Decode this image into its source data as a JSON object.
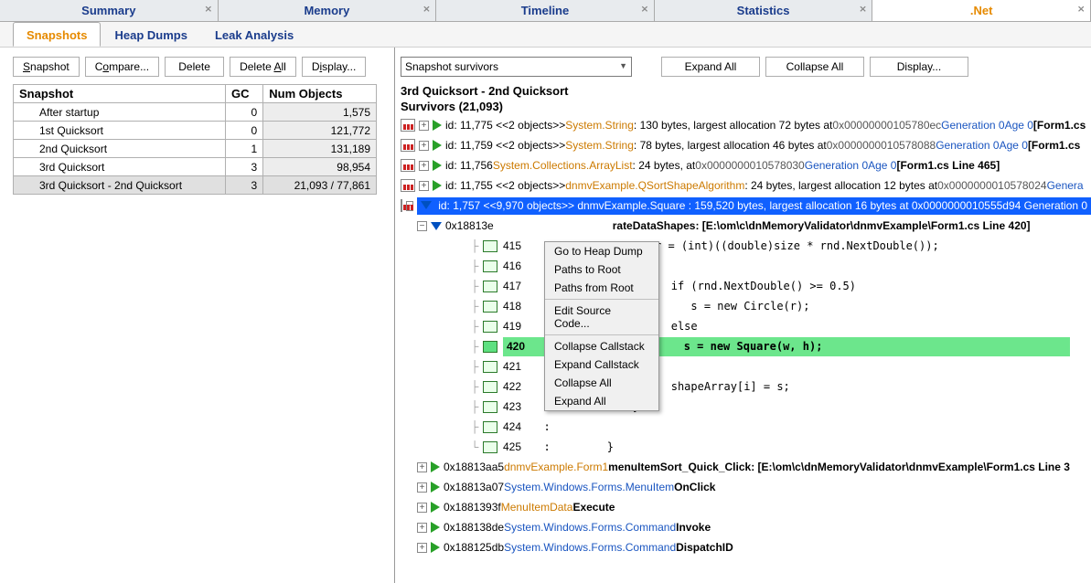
{
  "top_tabs": {
    "summary": "Summary",
    "memory": "Memory",
    "timeline": "Timeline",
    "statistics": "Statistics",
    "dotnet": ".Net"
  },
  "sub_tabs": {
    "snapshots": "Snapshots",
    "heap_dumps": "Heap Dumps",
    "leak_analysis": "Leak Analysis"
  },
  "left_toolbar": {
    "snapshot": "Snapshot",
    "compare": "Compare...",
    "delete": "Delete",
    "delete_all": "Delete All",
    "display": "Display..."
  },
  "snap_table": {
    "headers": {
      "snapshot": "Snapshot",
      "gc": "GC",
      "num": "Num Objects"
    },
    "rows": [
      {
        "name": "After startup",
        "gc": "0",
        "num": "1,575"
      },
      {
        "name": "1st Quicksort",
        "gc": "0",
        "num": "121,772"
      },
      {
        "name": "2nd Quicksort",
        "gc": "1",
        "num": "131,189"
      },
      {
        "name": "3rd Quicksort",
        "gc": "3",
        "num": "98,954"
      },
      {
        "name": "3rd Quicksort - 2nd Quicksort",
        "gc": "3",
        "num": "21,093 / 77,861"
      }
    ]
  },
  "right_toolbar": {
    "filter": "Snapshot survivors",
    "expand_all": "Expand All",
    "collapse_all": "Collapse All",
    "display": "Display..."
  },
  "diff_title": "3rd Quicksort - 2nd Quicksort",
  "survivors": "Survivors (21,093)",
  "tree_rows": {
    "r1": {
      "id": "id: 11,775 <<2 objects>> ",
      "type": "System.String",
      "rest": " : 130 bytes, largest allocation 72 bytes at ",
      "addr": "0x00000000105780ec ",
      "gen": "Generation 0 ",
      "age": "Age 0 ",
      "loc": "[Form1.cs"
    },
    "r2": {
      "id": "id: 11,759 <<2 objects>> ",
      "type": "System.String",
      "rest": " : 78 bytes, largest allocation 46 bytes at ",
      "addr": "0x0000000010578088 ",
      "gen": "Generation 0 ",
      "age": "Age 0 ",
      "loc": "[Form1.cs"
    },
    "r3": {
      "id": "id: 11,756 ",
      "type": "System.Collections.ArrayList",
      "rest": " : 24 bytes, at ",
      "addr": "0x0000000010578030 ",
      "gen": "Generation 0 ",
      "age": "Age 0 ",
      "loc": "[Form1.cs Line 465]"
    },
    "r4": {
      "id": "id: 11,755 <<2 objects>> ",
      "type": "dnmvExample.QSortShapeAlgorithm",
      "rest": " : 24 bytes, largest allocation 12 bytes at ",
      "addr": "0x0000000010578024 ",
      "gen": "Genera"
    },
    "sel": {
      "id": "id: 1,757 <<9,970 objects>> ",
      "type": "dnmvExample.Square",
      "rest": " : 159,520 bytes, largest allocation 16 bytes at ",
      "addr": "0x0000000010555d94 ",
      "gen": "Generation 0 "
    },
    "shapes": {
      "addr": "0x18813e",
      "method": "rateDataShapes",
      "path": " : [E:\\om\\c\\dnMemoryValidator\\dnmvExample\\Form1.cs Line 420]"
    },
    "code_415": "r = (int)((double)size * rnd.NextDouble());",
    "code_417": "if (rnd.NextDouble() >= 0.5)",
    "code_418": "   s = new Circle(r);",
    "code_419": "else",
    "code_420": "   s = new Square(w, h);",
    "code_422": "shapeArray[i] = s;",
    "code_423": "}",
    "code_425": "}",
    "cs1": {
      "addr": "0x18813aa5 ",
      "type": "dnmvExample.Form1",
      "method": " menuItemSort_Quick_Click",
      "path": " : [E:\\om\\c\\dnMemoryValidator\\dnmvExample\\Form1.cs Line 3"
    },
    "cs2": {
      "addr": "0x18813a07 ",
      "type": "System.Windows.Forms.MenuItem",
      "method": " OnClick"
    },
    "cs3": {
      "addr": "0x1881393f ",
      "type": "MenuItemData",
      "method": " Execute"
    },
    "cs4": {
      "addr": "0x188138de ",
      "type": "System.Windows.Forms.Command",
      "method": " Invoke"
    },
    "cs5": {
      "addr": "0x188125db ",
      "type": "System.Windows.Forms.Command",
      "method": " DispatchID"
    }
  },
  "lines": {
    "l415": "415",
    "l416": "416",
    "l417": "417",
    "l418": "418",
    "l419": "419",
    "l420": "420",
    "l421": "421",
    "l422": "422",
    "l423": "423",
    "l424": "424",
    "l425": "425"
  },
  "context_menu": {
    "goto_heap": "Go to Heap Dump",
    "paths_to": "Paths to Root",
    "paths_from": "Paths from Root",
    "edit_src": "Edit Source Code...",
    "collapse_cs": "Collapse Callstack",
    "expand_cs": "Expand Callstack",
    "collapse_all": "Collapse All",
    "expand_all": "Expand All"
  }
}
